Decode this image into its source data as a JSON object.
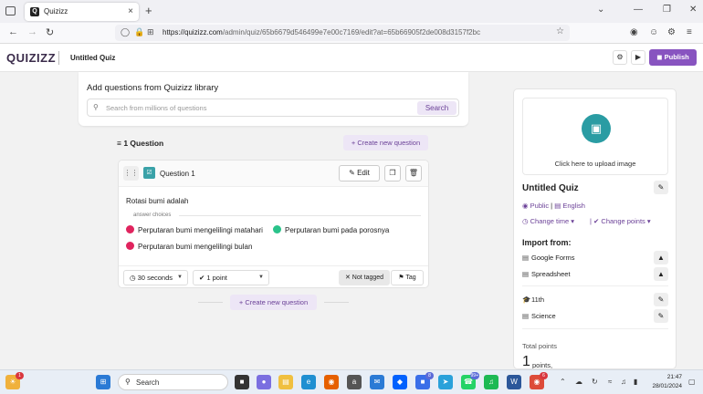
{
  "browser": {
    "tab_title": "Quizizz",
    "tab_close": "×",
    "new_tab": "+",
    "url_host": "https://quizizz.com",
    "url_path": "/admin/quiz/65b6679d546499e7e00c7169/edit?at=65b66905f2de008d3157f2bc"
  },
  "header": {
    "logo": "QUIZIZZ",
    "quiz_title": "Untitled Quiz",
    "publish_label": "Publish"
  },
  "library": {
    "heading": "Add questions from Quizizz library",
    "search_placeholder": "Search from millions of questions",
    "search_button": "Search"
  },
  "questions": {
    "count_label": "1 Question",
    "create_label": "Create new question",
    "items": [
      {
        "label": "Question 1",
        "edit_label": "Edit",
        "text": "Rotasi bumi adalah",
        "answer_choices_label": "answer choices",
        "choices": [
          {
            "text": "Perputaran bumi mengelilingi matahari",
            "correct": false
          },
          {
            "text": "Perputaran bumi pada porosnya",
            "correct": true
          },
          {
            "text": "Perputaran bumi mengelilingi bulan",
            "correct": false
          }
        ],
        "time": "30 seconds",
        "points": "1 point",
        "tag_status": "Not tagged",
        "tag_label": "Tag"
      }
    ]
  },
  "panel": {
    "upload_text": "Click here to upload image",
    "title": "Untitled Quiz",
    "visibility": "Public",
    "language": "English",
    "change_time": "Change time",
    "change_points": "Change points",
    "import_heading": "Import from:",
    "import_sources": [
      "Google Forms",
      "Spreadsheet"
    ],
    "grade": "11th",
    "subject": "Science",
    "total_points_label": "Total points",
    "total_points_value": "1",
    "total_points_unit": "points,"
  },
  "taskbar": {
    "search_label": "Search",
    "time": "21:47",
    "date": "28/01/2024",
    "badges": {
      "widgets": "1",
      "app1": "8",
      "whatsapp": "99+",
      "chrome": "6"
    }
  },
  "colors": {
    "brand_purple": "#8854c0",
    "teal": "#2a9ca3",
    "incorrect": "#e0245e",
    "correct": "#2ac38a"
  }
}
